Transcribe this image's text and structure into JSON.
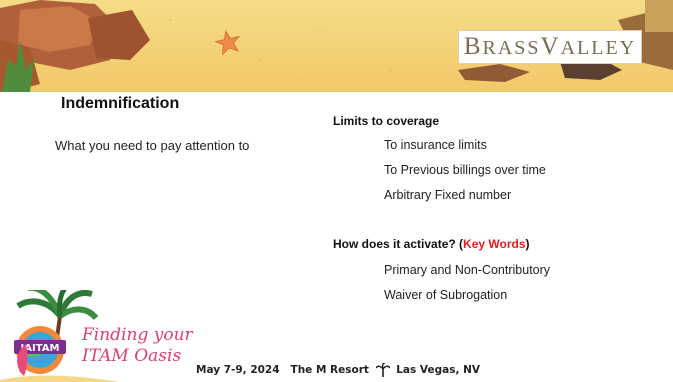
{
  "brand": {
    "logo_first_big": "B",
    "logo_first_rest": "RASS",
    "logo_second_big": "V",
    "logo_second_rest": "ALLEY"
  },
  "slide": {
    "title": "Indemnification",
    "subtitle": "What you need to pay attention to",
    "section1": {
      "heading": "Limits to coverage",
      "items": [
        "To insurance limits",
        "To Previous billings over time",
        "Arbitrary Fixed number"
      ]
    },
    "section2": {
      "heading_prefix": "How does it activate? (",
      "heading_keyword": "Key Words",
      "heading_suffix": ")",
      "items": [
        "Primary and Non-Contributory",
        "Waiver of Subrogation"
      ]
    }
  },
  "footer": {
    "badge_text": "IAITAM",
    "oasis_line1": "Finding your",
    "oasis_line2": "ITAM Oasis",
    "event_date": "May 7-9, 2024",
    "event_venue": "The M Resort",
    "event_city": "Las Vegas, NV"
  },
  "colors": {
    "accent_red": "#e02020",
    "oasis_pink": "#d9407a",
    "sand": "#f3d27a"
  },
  "icons": [
    "starfish-icon",
    "palm-tree-icon",
    "crab-icon"
  ]
}
